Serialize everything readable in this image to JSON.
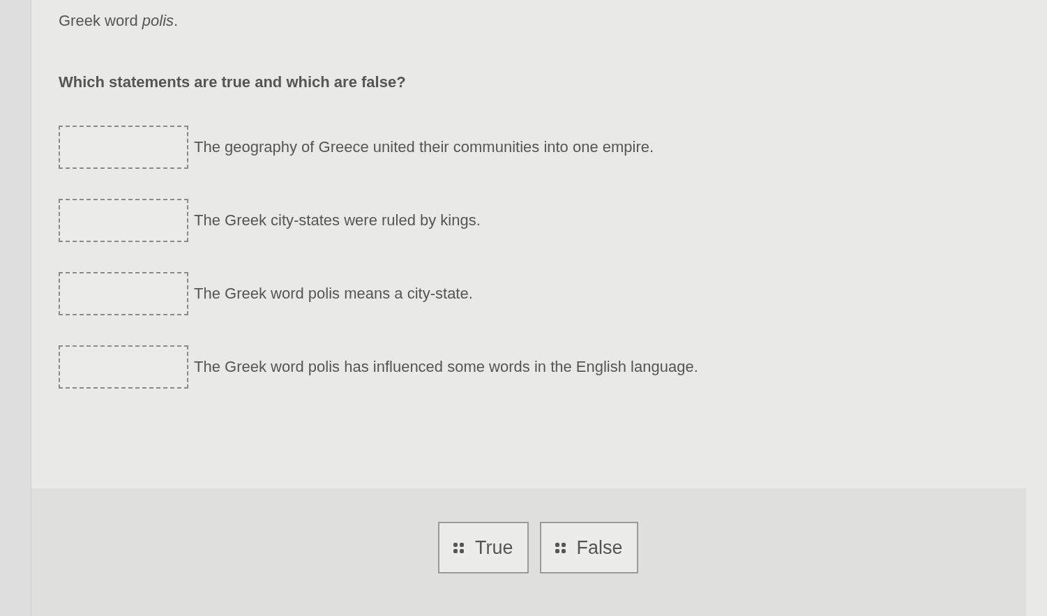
{
  "intro": {
    "text": "Greek word *polis*."
  },
  "question": "Which statements are true and which are false?",
  "statements": [
    {
      "text": "The geography of Greece united their communities into one empire."
    },
    {
      "text": "The Greek city-states were ruled by kings."
    },
    {
      "text": "The Greek word polis means a city-state."
    },
    {
      "text": "The Greek word polis has influenced some words in the English language."
    }
  ],
  "options": [
    {
      "label": "True"
    },
    {
      "label": "False"
    }
  ]
}
